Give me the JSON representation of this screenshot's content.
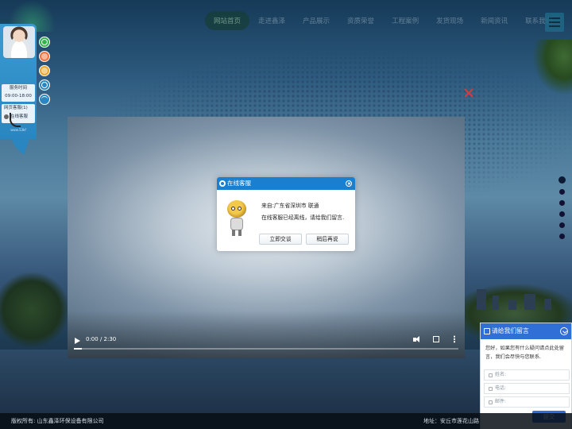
{
  "nav": {
    "items": [
      "网站首页",
      "走进鑫泽",
      "产品展示",
      "资质荣誉",
      "工程案例",
      "发货现场",
      "新闻资讯",
      "联系我们"
    ],
    "active_index": 0
  },
  "service_panel": {
    "hours_label": "服务时间",
    "hours_value": "09:00-18:00",
    "web_service_label": "网页客服(1)",
    "online_label": "在线客服",
    "footer_text": "www.53kf"
  },
  "video": {
    "time": "0:00 / 2:30",
    "progress": 0.0
  },
  "chat_dialog": {
    "title": "在线客服",
    "from": "来自:广东省深圳市 联通",
    "message": "在线客服已经离线，请给我们留言.",
    "primary_button": "立即交谈",
    "secondary_button": "稍后再说"
  },
  "leave_message": {
    "title": "请给我们留言",
    "intro": "您好，如果您有什么疑问请点此处留言，我们会尽快与您联系.",
    "fields": {
      "name_placeholder": "姓名:",
      "phone_placeholder": "电话:",
      "email_placeholder": "邮件:"
    },
    "submit_label": "提交"
  },
  "footer": {
    "copyright": "版权所有:   山东鑫泽环保设备有限公司",
    "address": "地址：安丘市莲花山路"
  },
  "colors": {
    "chat_header": "#1b7fd0",
    "leave_header": "#2f6fd6",
    "close_x": "#d83b3b",
    "service_panel": "#2a86c0"
  }
}
